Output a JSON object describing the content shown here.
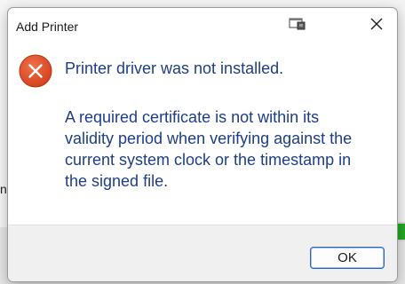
{
  "dialog": {
    "title": "Add Printer",
    "main_instruction": "Printer driver was not installed.",
    "message_lines": [
      "A required certificate is not within its",
      "validity period when verifying against the",
      "current system clock or the timestamp in",
      "the signed file."
    ],
    "icon": "error-icon",
    "ok_label": "OK",
    "title_app_icon": "window-app-icon",
    "close_icon": "close-icon"
  },
  "colors": {
    "instruction_text": "#1e3e8a",
    "error_icon_fill": "#e24a1f",
    "ok_border": "#2d62c0",
    "footer_background": "#f0f0f0"
  }
}
